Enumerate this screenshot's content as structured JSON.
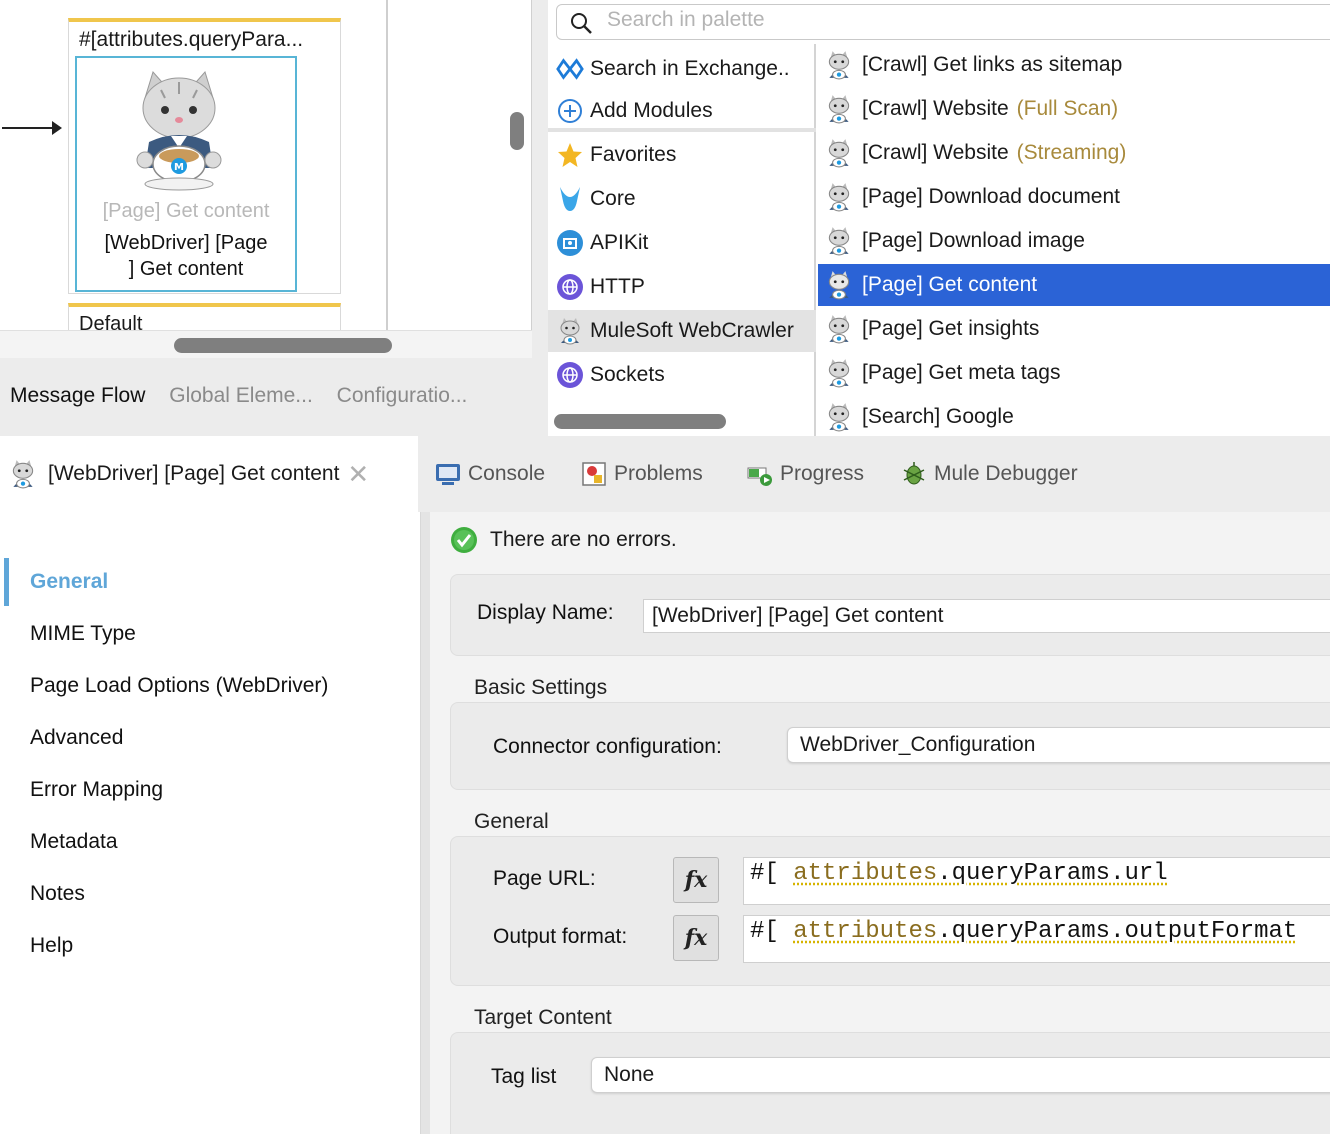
{
  "canvas": {
    "scope_title": "#[attributes.queryPara...",
    "component_type": "[Page] Get content",
    "component_name": "[WebDriver] [Page\n] Get content",
    "default_label": "Default",
    "tabs": [
      {
        "label": "Message Flow",
        "active": true
      },
      {
        "label": "Global Eleme...",
        "active": false
      },
      {
        "label": "Configuratio...",
        "active": false
      }
    ]
  },
  "palette": {
    "search_placeholder": "Search in palette",
    "categories": [
      {
        "label": "Search in Exchange..",
        "icon": "exchange-icon"
      },
      {
        "label": "Add Modules",
        "icon": "add-circle-icon"
      },
      {
        "label": "Favorites",
        "icon": "star-icon"
      },
      {
        "label": "Core",
        "icon": "core-icon"
      },
      {
        "label": "APIKit",
        "icon": "apikit-icon"
      },
      {
        "label": "HTTP",
        "icon": "http-globe-icon"
      },
      {
        "label": "MuleSoft WebCrawler",
        "icon": "webcrawler-icon",
        "selected": true
      },
      {
        "label": "Sockets",
        "icon": "sockets-globe-icon"
      }
    ],
    "operations": [
      {
        "label": "[Crawl] Get links as sitemap",
        "hint": ""
      },
      {
        "label": "[Crawl] Website",
        "hint": "(Full Scan)"
      },
      {
        "label": "[Crawl] Website",
        "hint": "(Streaming)"
      },
      {
        "label": "[Page] Download document",
        "hint": ""
      },
      {
        "label": "[Page] Download image",
        "hint": ""
      },
      {
        "label": "[Page] Get content",
        "hint": "",
        "selected": true
      },
      {
        "label": "[Page] Get insights",
        "hint": ""
      },
      {
        "label": "[Page] Get meta tags",
        "hint": ""
      },
      {
        "label": "[Search] Google",
        "hint": ""
      }
    ]
  },
  "tabbar": {
    "editor_tab": "[WebDriver] [Page] Get content",
    "views": [
      {
        "label": "Console",
        "icon": "console-icon"
      },
      {
        "label": "Problems",
        "icon": "problems-icon"
      },
      {
        "label": "Progress",
        "icon": "progress-icon"
      },
      {
        "label": "Mule Debugger",
        "icon": "debugger-bug-icon"
      }
    ]
  },
  "nav": {
    "items": [
      "General",
      "MIME Type",
      "Page Load Options (WebDriver)",
      "Advanced",
      "Error Mapping",
      "Metadata",
      "Notes",
      "Help"
    ],
    "active": "General"
  },
  "props": {
    "status": "There are no errors.",
    "display_name_label": "Display Name:",
    "display_name_value": "[WebDriver] [Page] Get content",
    "basic_settings_title": "Basic Settings",
    "connector_config_label": "Connector configuration:",
    "connector_config_value": "WebDriver_Configuration",
    "general_title": "General",
    "page_url_label": "Page URL:",
    "page_url_prefix": "#[",
    "page_url_attr": "attributes",
    "page_url_rest": ".queryParams.url",
    "output_format_label": "Output format:",
    "output_format_prefix": "#[",
    "output_format_attr": "attributes",
    "output_format_rest": ".queryParams.outputFormat",
    "fx_label": "fx",
    "target_content_title": "Target Content",
    "tag_list_label": "Tag list",
    "tag_list_value": "None"
  },
  "colors": {
    "selection_blue": "#2b63d6",
    "nav_active": "#5fa6d8",
    "scope_border": "#f0c64c",
    "component_border": "#58b5d6",
    "hint_gold": "#a88a3c"
  }
}
